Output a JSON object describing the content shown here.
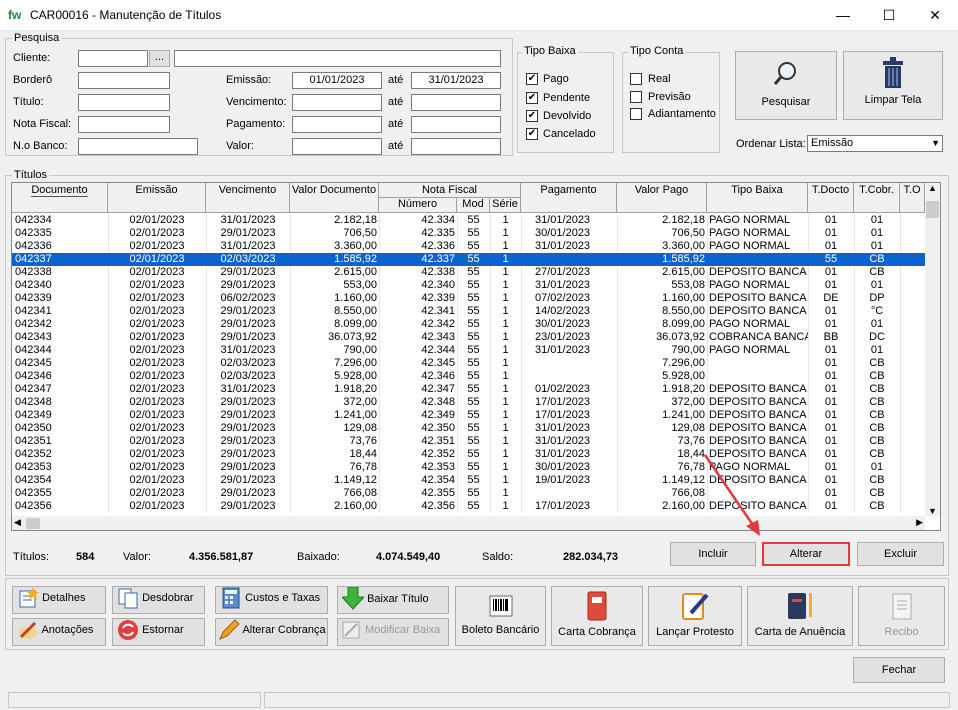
{
  "window": {
    "logo": "fw",
    "title": "CAR00016 - Manutenção de Títulos",
    "min": "—",
    "max": "☐",
    "close": "✕"
  },
  "pesquisa": {
    "group": "Pesquisa",
    "cliente_label": "Cliente:",
    "cliente_btn": "...",
    "bordero_label": "Borderô",
    "titulo_label": "Título:",
    "nf_label": "Nota Fiscal:",
    "banco_label": "N.o Banco:",
    "emissao_label": "Emissão:",
    "emissao_de": "01/01/2023",
    "emissao_ate": "31/01/2023",
    "ate": "até",
    "vencimento_label": "Vencimento:",
    "pagamento_label": "Pagamento:",
    "valor_label": "Valor:"
  },
  "tipo_baixa": {
    "group": "Tipo Baixa",
    "items": [
      {
        "label": "Pago",
        "checked": "✔"
      },
      {
        "label": "Pendente",
        "checked": "✔"
      },
      {
        "label": "Devolvido",
        "checked": "✔"
      },
      {
        "label": "Cancelado",
        "checked": "✔"
      }
    ]
  },
  "tipo_conta": {
    "group": "Tipo Conta",
    "items": [
      {
        "label": "Real"
      },
      {
        "label": "Previsão"
      },
      {
        "label": "Adiantamento"
      }
    ]
  },
  "actions": {
    "pesquisar": "Pesquisar",
    "limpar": "Limpar Tela",
    "ordenar_label": "Ordenar Lista:",
    "ordenar_value": "Emissão"
  },
  "grid": {
    "group": "Títulos",
    "headers": {
      "documento": "Documento",
      "emissao": "Emissão",
      "vencimento": "Vencimento",
      "valor_doc": "Valor Documento",
      "nota_fiscal": "Nota Fiscal",
      "numero": "Número",
      "mod": "Mod",
      "serie": "Série",
      "pagamento": "Pagamento",
      "valor_pago": "Valor Pago",
      "tipo_baixa": "Tipo Baixa",
      "t_docto": "T.Docto",
      "t_cobr": "T.Cobr.",
      "t_o": "T.O"
    },
    "rows": [
      [
        "042334",
        "02/01/2023",
        "31/01/2023",
        "2.182,18",
        "42.334",
        "55",
        "1",
        "31/01/2023",
        "2.182,18",
        "PAGO NORMAL",
        "01",
        "01"
      ],
      [
        "042335",
        "02/01/2023",
        "29/01/2023",
        "706,50",
        "42.335",
        "55",
        "1",
        "30/01/2023",
        "706,50",
        "PAGO NORMAL",
        "01",
        "01"
      ],
      [
        "042336",
        "02/01/2023",
        "31/01/2023",
        "3.360,00",
        "42.336",
        "55",
        "1",
        "31/01/2023",
        "3.360,00",
        "PAGO NORMAL",
        "01",
        "01"
      ],
      [
        "042337",
        "02/01/2023",
        "02/03/2023",
        "1.585,92",
        "42.337",
        "55",
        "1",
        "",
        "1.585,92",
        "",
        "55",
        "CB"
      ],
      [
        "042338",
        "02/01/2023",
        "29/01/2023",
        "2.615,00",
        "42.338",
        "55",
        "1",
        "27/01/2023",
        "2.615,00",
        "DEPOSITO BANCA",
        "01",
        "CB"
      ],
      [
        "042340",
        "02/01/2023",
        "29/01/2023",
        "553,00",
        "42.340",
        "55",
        "1",
        "31/01/2023",
        "553,08",
        "PAGO NORMAL",
        "01",
        "01"
      ],
      [
        "042339",
        "02/01/2023",
        "06/02/2023",
        "1.160,00",
        "42.339",
        "55",
        "1",
        "07/02/2023",
        "1.160,00",
        "DEPOSITO BANCA",
        "DE",
        "DP"
      ],
      [
        "042341",
        "02/01/2023",
        "29/01/2023",
        "8.550,00",
        "42.341",
        "55",
        "1",
        "14/02/2023",
        "8.550,00",
        "DEPOSITO BANCA",
        "01",
        "°C"
      ],
      [
        "042342",
        "02/01/2023",
        "29/01/2023",
        "8.099,00",
        "42.342",
        "55",
        "1",
        "30/01/2023",
        "8.099,00",
        "PAGO NORMAL",
        "01",
        "01"
      ],
      [
        "042343",
        "02/01/2023",
        "29/01/2023",
        "36.073,92",
        "42.343",
        "55",
        "1",
        "23/01/2023",
        "36.073,92",
        "COBRANCA BANCA",
        "BB",
        "DC"
      ],
      [
        "042344",
        "02/01/2023",
        "31/01/2023",
        "790,00",
        "42.344",
        "55",
        "1",
        "31/01/2023",
        "790,00",
        "PAGO NORMAL",
        "01",
        "01"
      ],
      [
        "042345",
        "02/01/2023",
        "02/03/2023",
        "7.296,00",
        "42.345",
        "55",
        "1",
        "",
        "7.296,00",
        "",
        "01",
        "CB"
      ],
      [
        "042346",
        "02/01/2023",
        "02/03/2023",
        "5.928,00",
        "42.346",
        "55",
        "1",
        "",
        "5.928,00",
        "",
        "01",
        "CB"
      ],
      [
        "042347",
        "02/01/2023",
        "31/01/2023",
        "1.918,20",
        "42.347",
        "55",
        "1",
        "01/02/2023",
        "1.918,20",
        "DEPOSITO BANCA",
        "01",
        "CB"
      ],
      [
        "042348",
        "02/01/2023",
        "29/01/2023",
        "372,00",
        "42.348",
        "55",
        "1",
        "17/01/2023",
        "372,00",
        "DEPOSITO BANCA",
        "01",
        "CB"
      ],
      [
        "042349",
        "02/01/2023",
        "29/01/2023",
        "1.241,00",
        "42.349",
        "55",
        "1",
        "17/01/2023",
        "1.241,00",
        "DEPOSITO BANCA",
        "01",
        "CB"
      ],
      [
        "042350",
        "02/01/2023",
        "29/01/2023",
        "129,08",
        "42.350",
        "55",
        "1",
        "31/01/2023",
        "129,08",
        "DEPOSITO BANCA",
        "01",
        "CB"
      ],
      [
        "042351",
        "02/01/2023",
        "29/01/2023",
        "73,76",
        "42.351",
        "55",
        "1",
        "31/01/2023",
        "73,76",
        "DEPOSITO BANCA",
        "01",
        "CB"
      ],
      [
        "042352",
        "02/01/2023",
        "29/01/2023",
        "18,44",
        "42.352",
        "55",
        "1",
        "31/01/2023",
        "18,44",
        "DEPOSITO BANCA",
        "01",
        "CB"
      ],
      [
        "042353",
        "02/01/2023",
        "29/01/2023",
        "76,78",
        "42.353",
        "55",
        "1",
        "30/01/2023",
        "76,78",
        "PAGO NORMAL",
        "01",
        "01"
      ],
      [
        "042354",
        "02/01/2023",
        "29/01/2023",
        "1.149,12",
        "42.354",
        "55",
        "1",
        "19/01/2023",
        "1.149,12",
        "DEPOSITO BANCA",
        "01",
        "CB"
      ],
      [
        "042355",
        "02/01/2023",
        "29/01/2023",
        "766,08",
        "42.355",
        "55",
        "1",
        "",
        "766,08",
        "",
        "01",
        "CB"
      ],
      [
        "042356",
        "02/01/2023",
        "29/01/2023",
        "2.160,00",
        "42.356",
        "55",
        "1",
        "17/01/2023",
        "2.160,00",
        "DEPOSITO BANCA",
        "01",
        "CB"
      ]
    ],
    "selected_row": 3
  },
  "summary": {
    "titulos_label": "Títulos:",
    "titulos": "584",
    "valor_label": "Valor:",
    "valor": "4.356.581,87",
    "baixado_label": "Baixado:",
    "baixado": "4.074.549,40",
    "saldo_label": "Saldo:",
    "saldo": "282.034,73"
  },
  "row_buttons": {
    "incluir": "Incluir",
    "alterar": "Alterar",
    "excluir": "Excluir"
  },
  "toolbar": {
    "detalhes": "Detalhes",
    "desdobrar": "Desdobrar",
    "custos": "Custos e Taxas",
    "baixar": "Baixar Título",
    "anotacoes": "Anotações",
    "estornar": "Estornar",
    "alterar_cobranca": "Alterar Cobrança",
    "modificar_baixa": "Modificar Baixa",
    "boleto": "Boleto Bancário",
    "carta_cobranca": "Carta Cobrança",
    "lancar_protesto": "Lançar Protesto",
    "carta_anuencia": "Carta de Anuência",
    "recibo": "Recibo"
  },
  "fechar": "Fechar",
  "colors": {
    "selection": "#0a64d0",
    "highlight": "#e0393e"
  }
}
